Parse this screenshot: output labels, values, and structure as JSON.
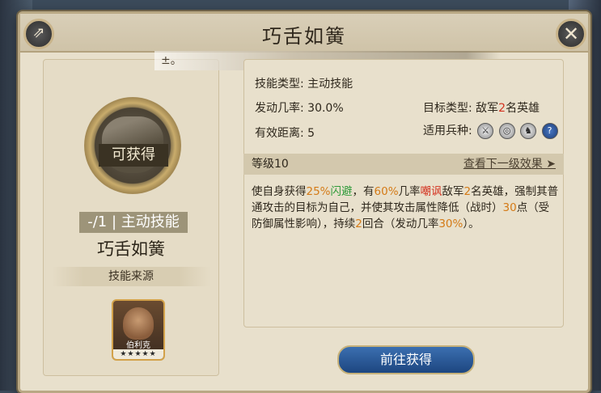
{
  "dialog": {
    "title": "巧舌如簧",
    "close_icon": "close-icon",
    "share_icon": "share-icon"
  },
  "left": {
    "obtainable_label": "可获得",
    "level_badge": "-/1 | 主动技能",
    "skill_name": "巧舌如簧",
    "source_label": "技能来源",
    "hero": {
      "name": "伯利克",
      "stars": "★★★★★"
    }
  },
  "right": {
    "top_fade_text": "±。",
    "skill_type_label": "技能类型:",
    "skill_type_value": "主动技能",
    "trigger_rate_label": "发动几率:",
    "trigger_rate_value": "30.0%",
    "target_type_label": "目标类型:",
    "target_type_value_prefix": "敌军",
    "target_type_value_num": "2",
    "target_type_value_suffix": "名英雄",
    "distance_label": "有效距离:",
    "distance_value": "5",
    "troop_label": "适用兵种:",
    "troop_icons": [
      "sword-icon",
      "target-icon",
      "horse-icon",
      "question-icon"
    ],
    "troop_q": "?",
    "level_label": "等级10",
    "next_level_label": "查看下一级效果 ➤",
    "description": {
      "p1": "使自身获得",
      "v1": "25%",
      "v1b": "闪避",
      "p2": "，有",
      "v2": "60%",
      "p3": "几率",
      "v3": "嘲讽",
      "p4": "敌军",
      "v4": "2",
      "p5": "名英雄，强制其普通攻击的目标为自己，并使其攻击属性降低（战时）",
      "v5": "30",
      "p6": "点（受防御属性影响），持续",
      "v6": "2",
      "p7": "回合（发动几率",
      "v7": "30%",
      "p8": "）。"
    },
    "go_button": "前往获得"
  },
  "colors": {
    "highlight_orange": "#d47a16",
    "highlight_green": "#2f9b3a",
    "highlight_red": "#d4311f",
    "button_blue": "#1d4680"
  }
}
